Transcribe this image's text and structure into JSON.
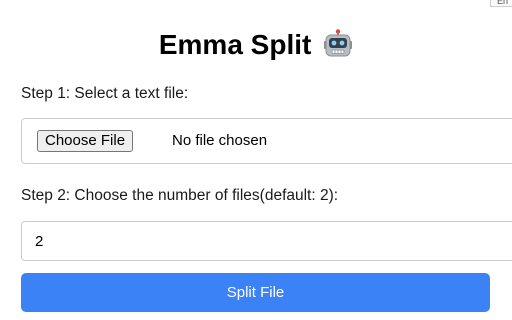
{
  "corner": {
    "label": "En"
  },
  "header": {
    "title": "Emma Split",
    "title_icon": "robot-face-icon"
  },
  "step1": {
    "label": "Step 1: Select a text file:"
  },
  "file_input": {
    "button_label": "Choose File",
    "status": "No file chosen"
  },
  "step2": {
    "label": "Step 2: Choose the number of files(default: 2):"
  },
  "count_input": {
    "value": "2"
  },
  "split_button": {
    "label": "Split File"
  },
  "colors": {
    "accent": "#3b82f6",
    "border": "#cccccc",
    "text": "#000000",
    "button_text": "#ffffff"
  }
}
